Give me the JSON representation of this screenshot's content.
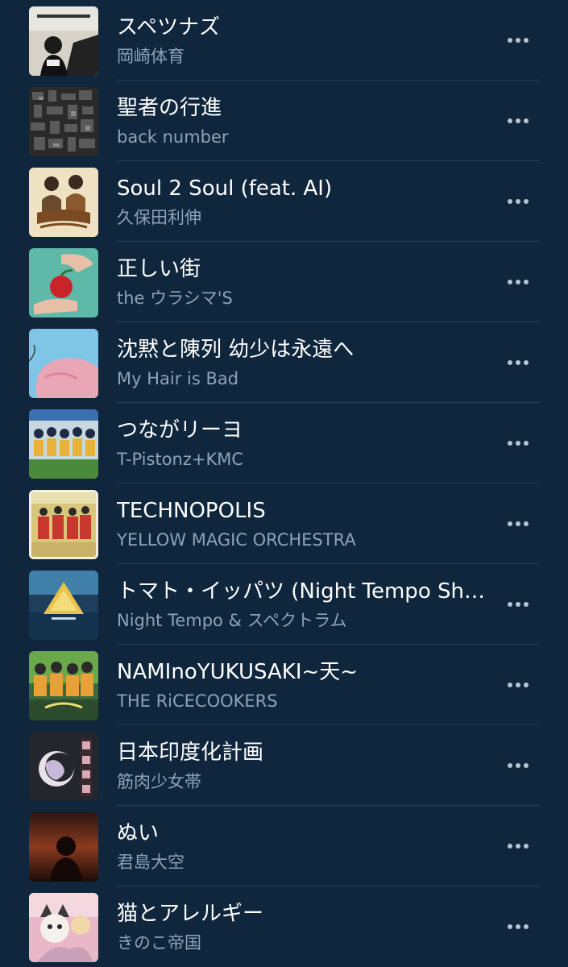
{
  "songs": [
    {
      "title": "スペツナズ",
      "artist": "岡崎体育",
      "art": "basin-techno-cover"
    },
    {
      "title": "聖者の行進",
      "artist": "back number",
      "art": "collage-cover"
    },
    {
      "title": "Soul 2 Soul (feat. AI)",
      "artist": "久保田利伸",
      "art": "baddest-collaboration-cover"
    },
    {
      "title": "正しい街",
      "artist": "the ウラシマ'S",
      "art": "apple-hands-cover"
    },
    {
      "title": "沈黙と陳列 幼少は永遠へ",
      "artist": "My Hair is Bad",
      "art": "pink-blob-cover"
    },
    {
      "title": "つながリーヨ",
      "artist": "T-Pistonz+KMC",
      "art": "inazuma-team-cover"
    },
    {
      "title": "TECHNOPOLIS",
      "artist": "YELLOW MAGIC ORCHESTRA",
      "art": "yellow-magic-cover"
    },
    {
      "title": "トマト・イッパツ (Night Tempo Showa Groove Mix)",
      "artist": "Night Tempo & スペクトラム",
      "art": "pyramid-cover"
    },
    {
      "title": "NAMInoYUKUSAKI~天~",
      "artist": "THE RiCECOOKERS",
      "art": "ricecookers-cover"
    },
    {
      "title": "日本印度化計画",
      "artist": "筋肉少女帯",
      "art": "kinniku-cover"
    },
    {
      "title": "ぬい",
      "artist": "君島大空",
      "art": "silhouette-cover"
    },
    {
      "title": "猫とアレルギー",
      "artist": "きのこ帝国",
      "art": "cat-cover"
    }
  ],
  "colors": {
    "background": "#0f263d",
    "title": "#ffffff",
    "artist": "#8ea3b8",
    "divider": "#2a3f54",
    "more_dots": "#b8c4d0"
  },
  "icons": {
    "more": "more-horizontal-icon"
  }
}
